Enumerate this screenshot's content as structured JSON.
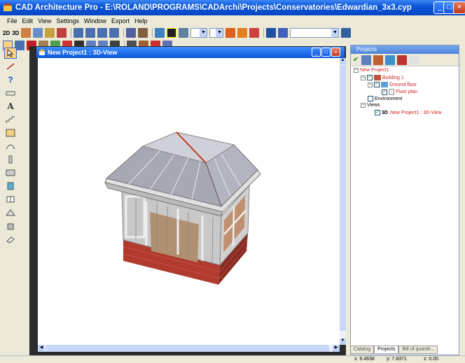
{
  "window": {
    "title": "CAD Architecture Pro - E:\\ROLAND\\PROGRAMS\\CADArchi\\Projects\\Conservatories\\Edwardian_3x3.cyp"
  },
  "menu": [
    "File",
    "Edit",
    "View",
    "Settings",
    "Window",
    "Export",
    "Help"
  ],
  "toolbar": {
    "view2d_label": "2D",
    "view3d_label": "3D"
  },
  "left_tools": {
    "text_tool_label": "A",
    "help_tool_label": "?"
  },
  "view_window": {
    "title": "New Project1 : 3D-View"
  },
  "projects_panel": {
    "title": "Projects",
    "tree": {
      "root": "New Project1",
      "building": "Building 1",
      "floor": "Ground floor",
      "plan": "Floor plan",
      "environment": "Environment",
      "views": "Views",
      "view_item_prefix": "3D",
      "view_item": "New Project1 : 3D-View"
    },
    "tabs": [
      "Catalog",
      "Projects",
      "Bill of quantit..."
    ],
    "active_tab": "Projects"
  },
  "status": {
    "x": "x: 9.4638",
    "y": "y: 7.8371",
    "z": "z: 0.00"
  },
  "colors": {
    "titlebar": "#0a56d8",
    "accent_red": "#d02020",
    "check": "#21a121"
  }
}
